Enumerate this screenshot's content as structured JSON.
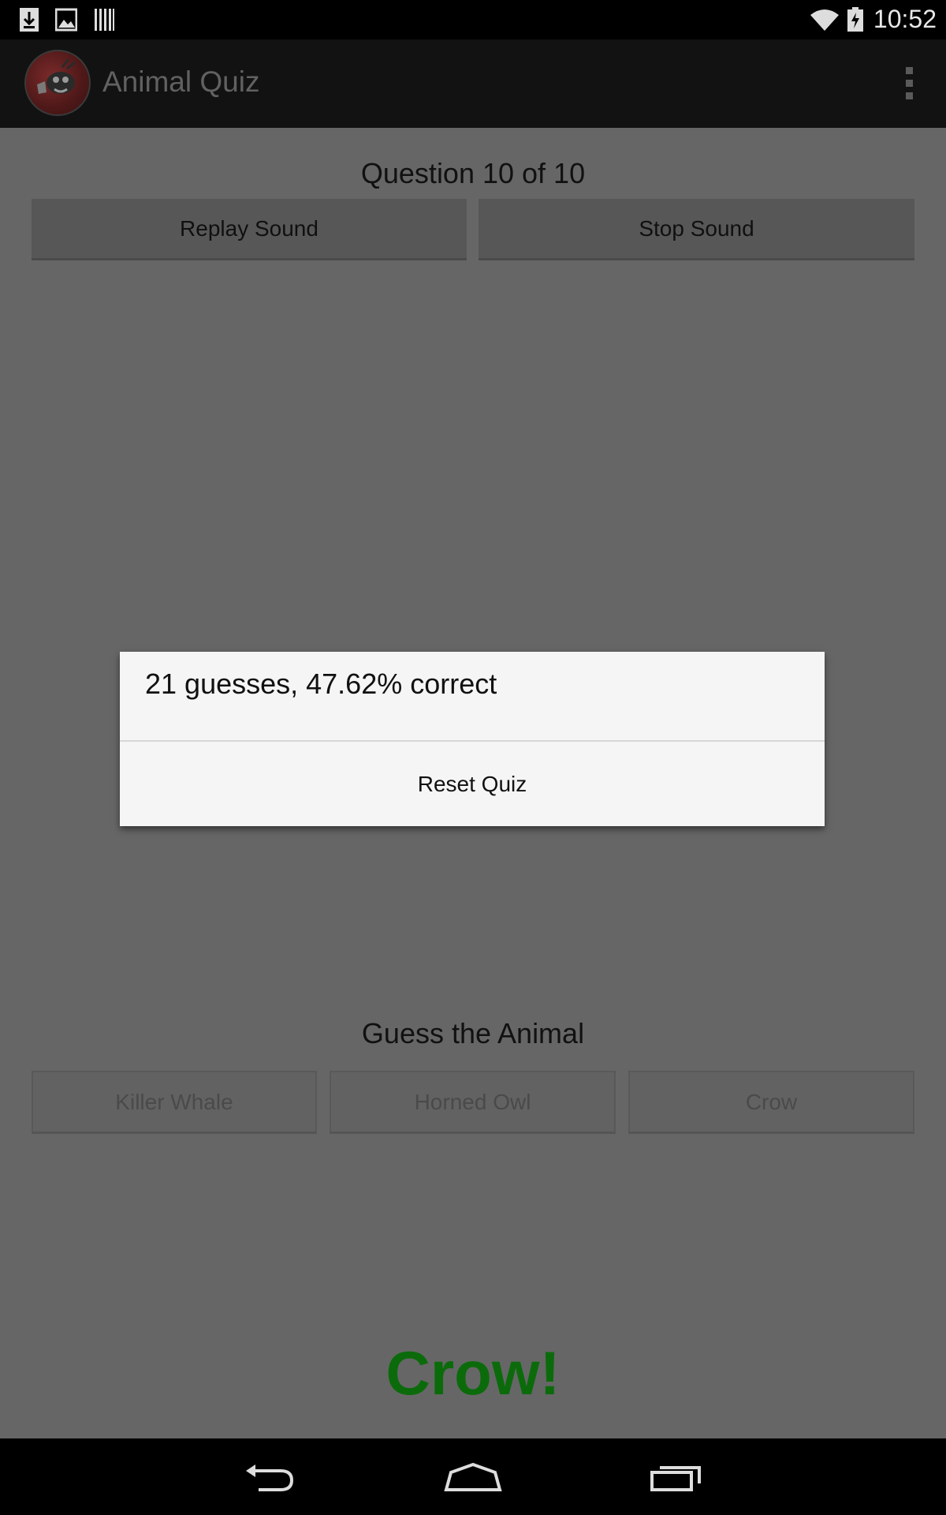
{
  "status_bar": {
    "time": "10:52",
    "left_icons": [
      "download-icon",
      "image-icon",
      "barcode-icon"
    ],
    "right_icons": [
      "wifi-icon",
      "battery-charging-icon"
    ]
  },
  "action_bar": {
    "title": "Animal Quiz",
    "logo": "app-logo",
    "menu_icon": "overflow-menu-icon"
  },
  "quiz": {
    "question_counter": "Question 10 of 10",
    "replay_label": "Replay Sound",
    "stop_label": "Stop Sound",
    "guess_label": "Guess the Animal",
    "choices": [
      "Killer Whale",
      "Horned Owl",
      "Crow"
    ],
    "answer": "Crow!"
  },
  "dialog": {
    "message": "21 guesses, 47.62% correct",
    "button_label": "Reset Quiz"
  },
  "nav_bar": {
    "buttons": [
      "back-icon",
      "home-icon",
      "recent-apps-icon"
    ]
  },
  "colors": {
    "answer": "#0b6b0b",
    "dialog_bg": "#f5f5f5",
    "scrim": "#666666"
  }
}
